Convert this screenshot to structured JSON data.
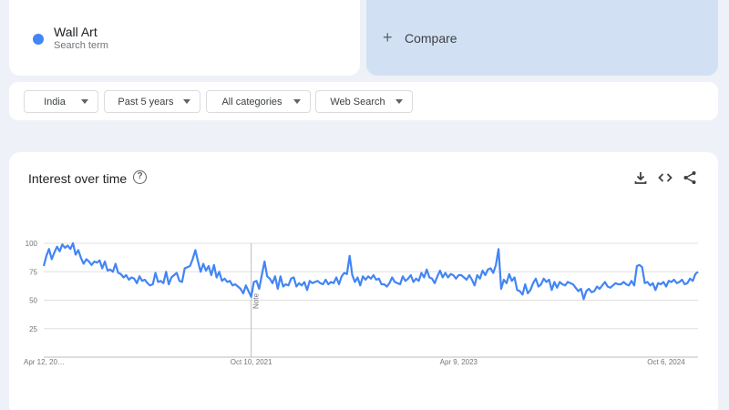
{
  "term": {
    "name": "Wall Art",
    "subtitle": "Search term",
    "color": "#4285f4"
  },
  "compare": {
    "plus": "+",
    "label": "Compare"
  },
  "filters": {
    "region": "India",
    "period": "Past 5 years",
    "category": "All categories",
    "property": "Web Search"
  },
  "interest": {
    "title": "Interest over time",
    "help": "?",
    "note_label": "Note"
  },
  "chart_data": {
    "type": "line",
    "title": "Interest over time",
    "xlabel": "",
    "ylabel": "",
    "ylim": [
      0,
      100
    ],
    "grid": true,
    "y_ticks": [
      "25",
      "50",
      "75",
      "100"
    ],
    "x_tick_labels": [
      "Apr 12, 20…",
      "Oct 10, 2021",
      "Apr 9, 2023",
      "Oct 6, 2024"
    ],
    "x_tick_weeks": [
      0,
      78,
      156,
      234
    ],
    "note_week": 78,
    "series": [
      {
        "color": "#4285f4",
        "values": [
          80,
          89,
          95,
          86,
          92,
          97,
          93,
          99,
          96,
          98,
          95,
          100,
          90,
          94,
          87,
          82,
          86,
          84,
          81,
          84,
          83,
          85,
          78,
          84,
          76,
          77,
          75,
          82,
          74,
          73,
          70,
          72,
          68,
          70,
          69,
          65,
          71,
          67,
          68,
          65,
          63,
          64,
          74,
          66,
          67,
          65,
          75,
          64,
          70,
          72,
          74,
          67,
          66,
          78,
          79,
          80,
          86,
          94,
          84,
          75,
          82,
          76,
          80,
          72,
          81,
          70,
          75,
          67,
          69,
          66,
          67,
          63,
          64,
          62,
          60,
          56,
          63,
          58,
          53,
          66,
          67,
          60,
          72,
          84,
          71,
          69,
          65,
          71,
          60,
          71,
          62,
          64,
          63,
          69,
          70,
          62,
          65,
          63,
          66,
          59,
          67,
          65,
          66,
          67,
          65,
          64,
          68,
          64,
          66,
          65,
          70,
          64,
          71,
          74,
          73,
          89,
          72,
          66,
          70,
          63,
          71,
          68,
          71,
          69,
          72,
          68,
          69,
          64,
          64,
          62,
          65,
          70,
          66,
          65,
          64,
          71,
          67,
          69,
          72,
          66,
          69,
          67,
          74,
          70,
          77,
          70,
          69,
          65,
          71,
          76,
          70,
          74,
          70,
          73,
          72,
          69,
          72,
          72,
          70,
          68,
          72,
          68,
          63,
          72,
          69,
          76,
          72,
          77,
          78,
          74,
          81,
          95,
          60,
          68,
          65,
          73,
          67,
          70,
          59,
          58,
          55,
          64,
          56,
          59,
          65,
          69,
          62,
          64,
          69,
          66,
          68,
          59,
          66,
          61,
          66,
          64,
          63,
          66,
          65,
          64,
          61,
          58,
          60,
          51,
          58,
          60,
          57,
          58,
          62,
          60,
          63,
          66,
          62,
          61,
          63,
          65,
          64,
          64,
          66,
          64,
          63,
          67,
          63,
          80,
          81,
          79,
          65,
          66,
          63,
          65,
          59,
          65,
          64,
          66,
          62,
          67,
          66,
          68,
          65,
          66,
          68,
          64,
          65,
          69,
          67,
          73,
          75
        ]
      }
    ]
  }
}
